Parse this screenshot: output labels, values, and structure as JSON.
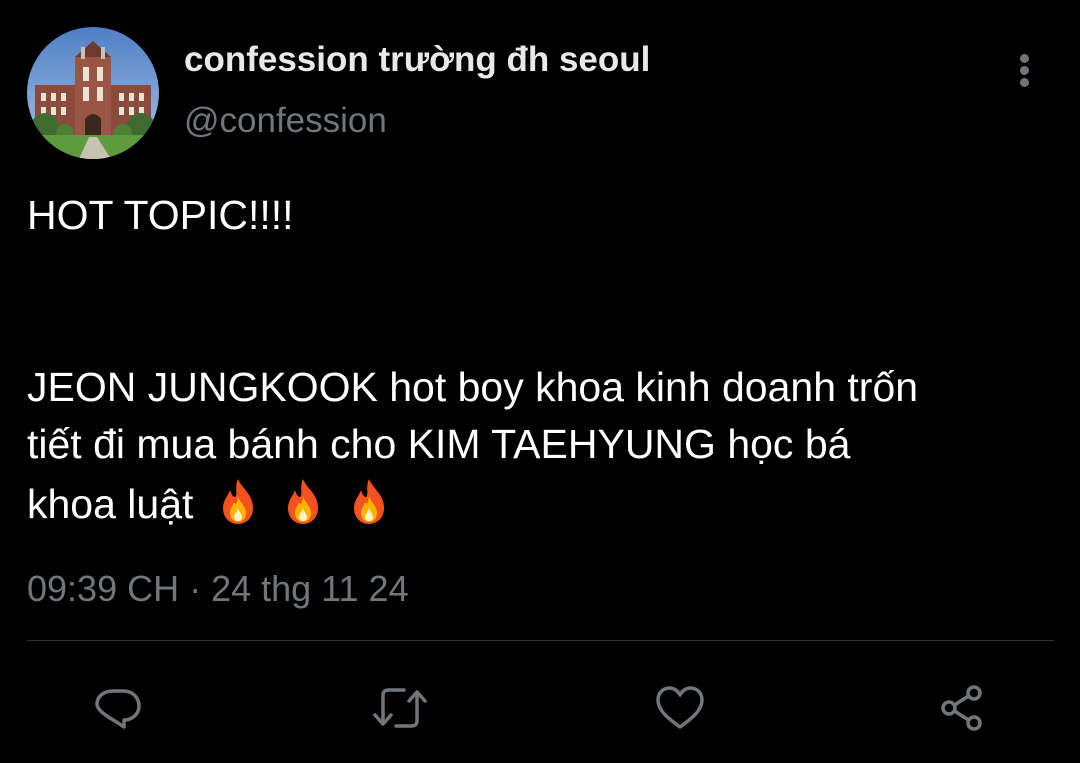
{
  "tweet": {
    "author": {
      "display_name": "confession trường đh seoul",
      "handle": "@confession",
      "avatar": "university-building-photo"
    },
    "text_lines": [
      "HOT TOPIC!!!!",
      "JEON JUNGKOOK hot boy khoa kinh doanh trốn",
      "tiết đi mua bánh cho KIM TAEHYUNG học bá",
      "khoa luật"
    ],
    "emojis": [
      "🔥",
      "🔥",
      "🔥"
    ],
    "timestamp": "09:39 CH · 24 thg 11 24",
    "more_icon": "more-vertical-icon"
  },
  "actions": [
    {
      "name": "reply",
      "icon": "comment-icon"
    },
    {
      "name": "retweet",
      "icon": "retweet-icon"
    },
    {
      "name": "like",
      "icon": "heart-icon"
    },
    {
      "name": "share",
      "icon": "share-icon"
    }
  ],
  "colors": {
    "background": "#000000",
    "primary_text": "#e7e9ea",
    "secondary_text": "#71767b",
    "divider": "#2f3336"
  }
}
